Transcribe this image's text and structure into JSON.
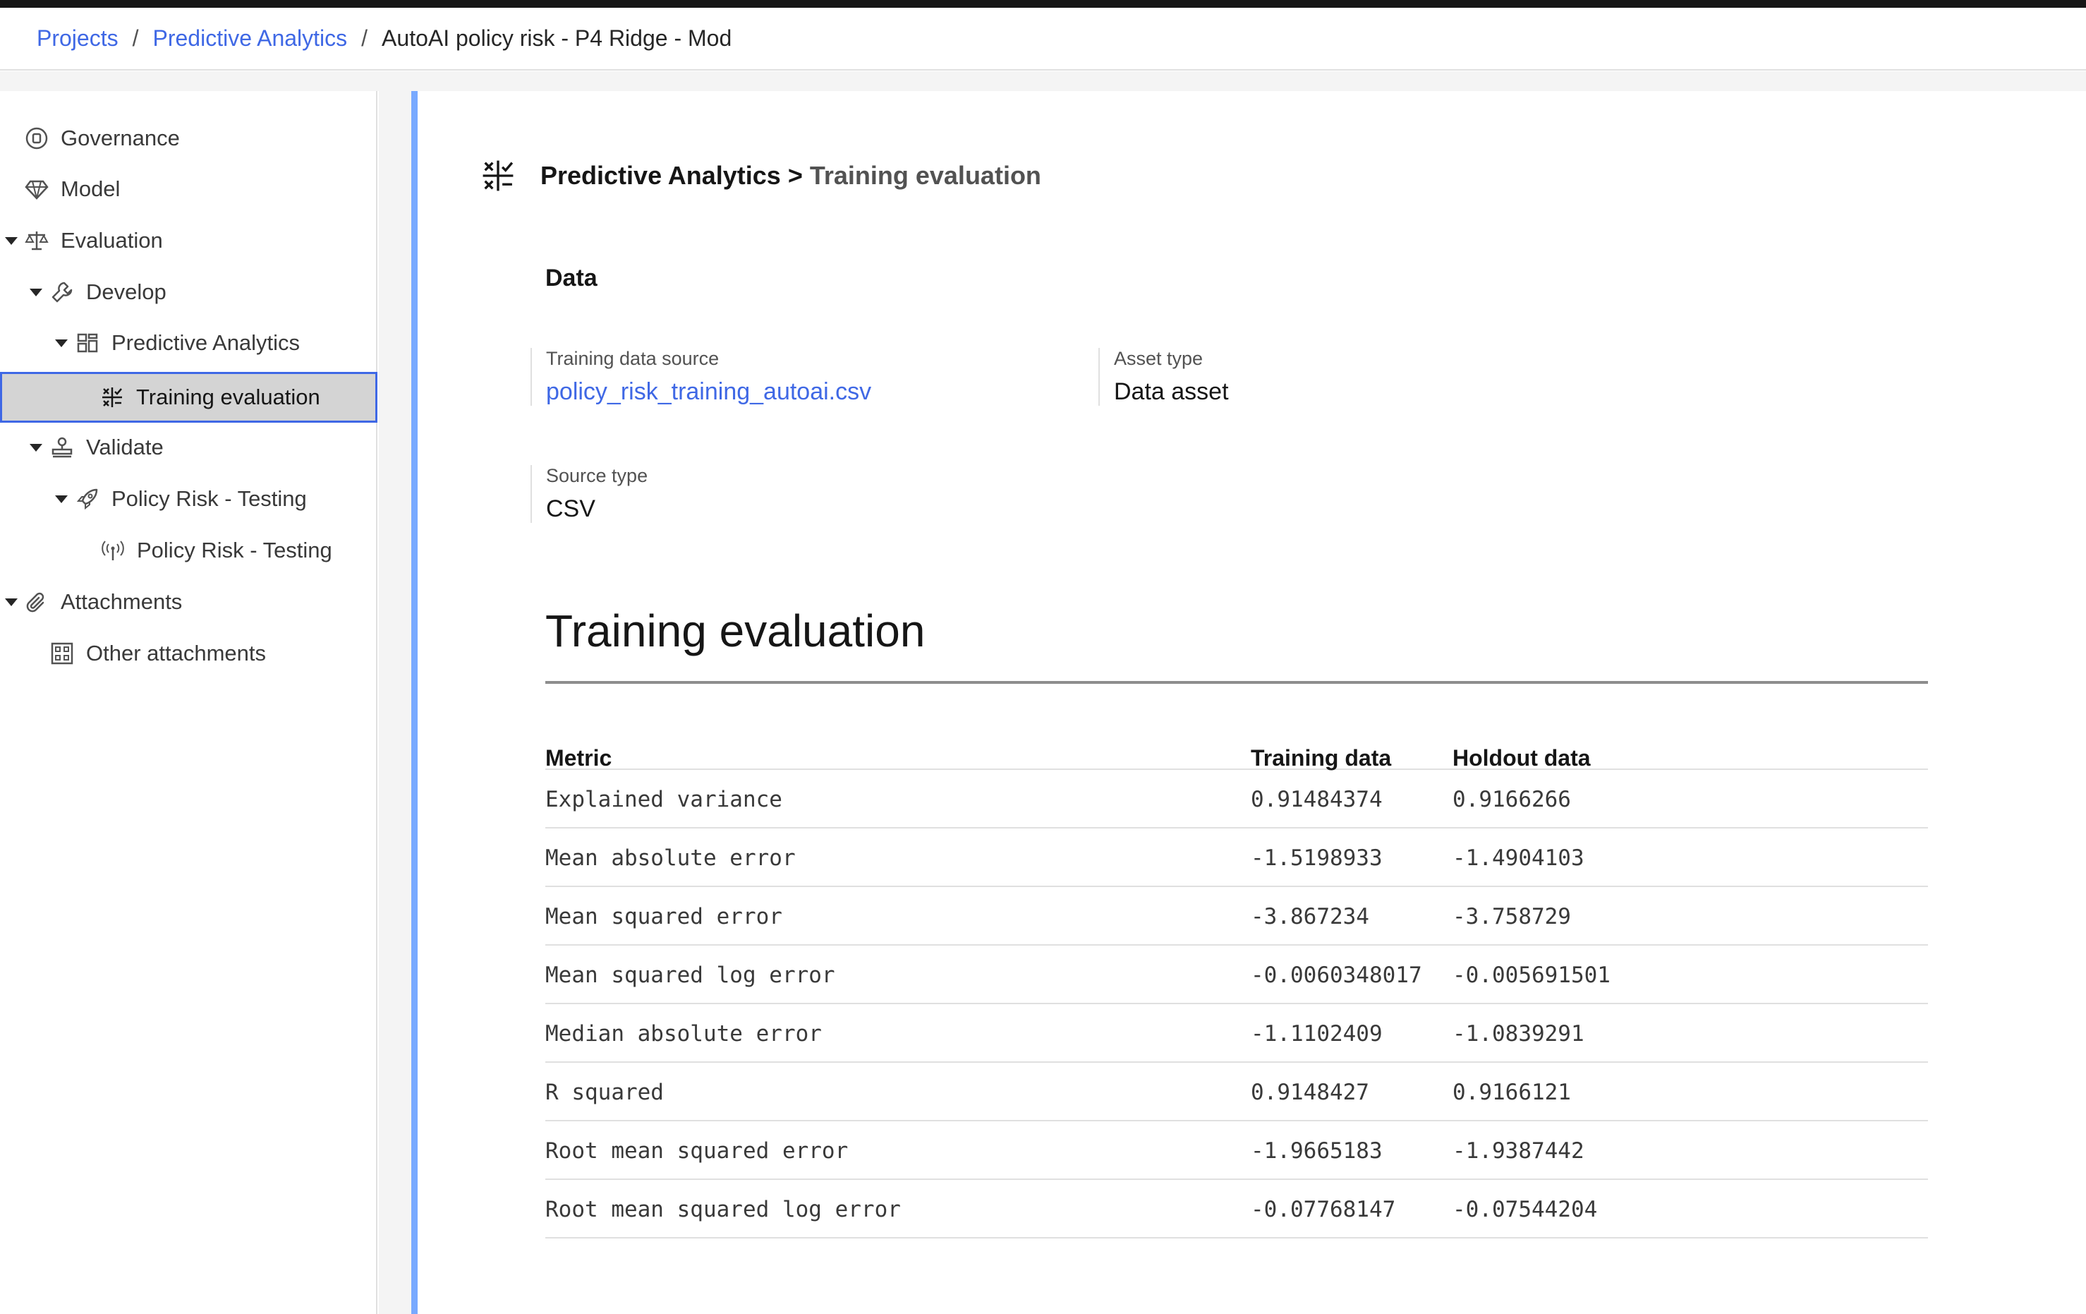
{
  "breadcrumb": {
    "items": [
      {
        "label": "Projects"
      },
      {
        "label": "Predictive Analytics"
      }
    ],
    "current": "AutoAI policy risk - P4 Ridge - Mod",
    "separator": "/"
  },
  "sidebar": {
    "items": [
      {
        "label": "Governance",
        "icon": "governance-icon"
      },
      {
        "label": "Model",
        "icon": "diamond-icon"
      },
      {
        "label": "Evaluation",
        "icon": "scales-icon",
        "expanded": true
      },
      {
        "label": "Develop",
        "icon": "wrench-icon",
        "expanded": true
      },
      {
        "label": "Predictive Analytics",
        "icon": "dashboard-icon",
        "expanded": true
      },
      {
        "label": "Training evaluation",
        "icon": "calculator-icon",
        "selected": true
      },
      {
        "label": "Validate",
        "icon": "stamp-icon",
        "expanded": true
      },
      {
        "label": "Policy Risk - Testing",
        "icon": "rocket-icon",
        "expanded": true
      },
      {
        "label": "Policy Risk - Testing",
        "icon": "antenna-icon"
      },
      {
        "label": "Attachments",
        "icon": "paperclip-icon",
        "expanded": true
      },
      {
        "label": "Other attachments",
        "icon": "grid-icon"
      }
    ]
  },
  "header": {
    "icon": "calculator-icon",
    "parent": "Predictive Analytics",
    "separator": ">",
    "title": "Training evaluation"
  },
  "data_section": {
    "title": "Data",
    "fields": [
      {
        "label": "Training data source",
        "value": "policy_risk_training_autoai.csv"
      },
      {
        "label": "Asset type",
        "value": "Data asset"
      },
      {
        "label": "Source type",
        "value": "CSV"
      }
    ]
  },
  "evaluation": {
    "title": "Training evaluation",
    "columns": [
      "Metric",
      "Training data",
      "Holdout data"
    ],
    "rows": [
      [
        "Explained variance",
        "0.91484374",
        "0.9166266"
      ],
      [
        "Mean absolute error",
        "-1.5198933",
        "-1.4904103"
      ],
      [
        "Mean squared error",
        "-3.867234",
        "-3.758729"
      ],
      [
        "Mean squared log error",
        "-0.0060348017",
        "-0.005691501"
      ],
      [
        "Median absolute error",
        "-1.1102409",
        "-1.0839291"
      ],
      [
        "R squared",
        "0.9148427",
        "0.9166121"
      ],
      [
        "Root mean squared error",
        "-1.9665183",
        "-1.9387442"
      ],
      [
        "Root mean squared log error",
        "-0.07768147",
        "-0.07544204"
      ]
    ]
  },
  "colors": {
    "link": "#3f68e5",
    "accent_bar": "#78a9ff",
    "selected_bg": "#d4d4d4"
  }
}
